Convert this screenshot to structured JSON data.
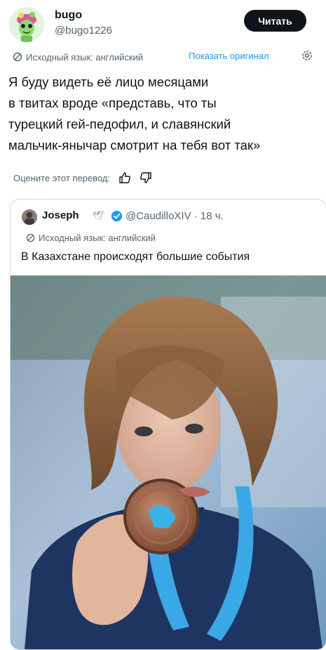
{
  "user": {
    "display_name": "bugo",
    "handle": "@bugo1226",
    "follow_label": "Читать"
  },
  "translation": {
    "source_label": "Исходный язык: английский",
    "show_original_label": "Показать оригинал"
  },
  "tweet": {
    "lines": [
      "Я буду видеть её лицо месяцами",
      "в твитах вроде «представь, что ты",
      "турецкий гей-педофил, и славянский",
      "мальчик-янычар смотрит на тебя вот так»"
    ]
  },
  "rating": {
    "prompt": "Оцените этот перевод:"
  },
  "quote": {
    "display_name": "Joseph",
    "handle_time": "@CaudilloXIV · 18 ч.",
    "translation_label": "Исходный язык: английский",
    "text": "В Казахстане происходят большие события",
    "icons": {
      "dove": "dove-emoji-icon",
      "verified": "verified-badge-icon",
      "verified_color": "#1d9bf0"
    }
  },
  "colors": {
    "accent": "#1d9bf0",
    "text": "#0f1419",
    "secondary": "#536471",
    "border": "#cfd9de",
    "button": "#0f1419"
  }
}
